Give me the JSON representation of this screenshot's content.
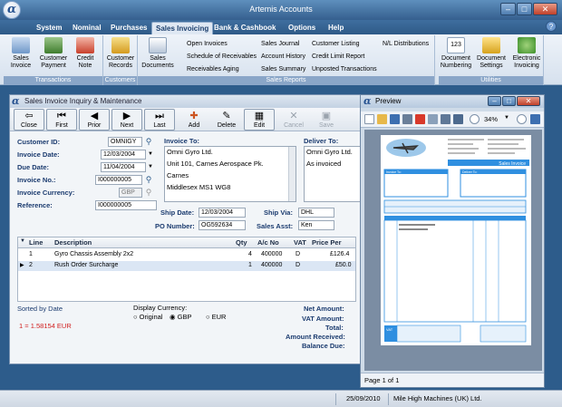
{
  "app": {
    "title": "Artemis Accounts",
    "logo_glyph": "α"
  },
  "window_controls": {
    "minimize": "–",
    "maximize": "□",
    "close": "✕"
  },
  "menu": [
    "System",
    "Nominal",
    "Purchases",
    "Sales Invoicing",
    "Bank & Cashbook",
    "Options",
    "Help"
  ],
  "help_icon": "?",
  "ribbon": {
    "transactions": {
      "label": "Transactions",
      "buttons": [
        "Sales Invoice",
        "Customer Payment",
        "Credit Note"
      ]
    },
    "customers": {
      "label": "Customers",
      "buttons": [
        "Customer Records"
      ]
    },
    "documents": {
      "buttons": [
        "Sales Documents"
      ]
    },
    "sales_reports": {
      "label": "Sales Reports",
      "links": [
        "Open Invoices",
        "Schedule of Receivables",
        "Receivables Aging",
        "Sales Journal",
        "Account History",
        "Sales Summary",
        "Customer Listing",
        "Credit Limit Report",
        "Unposted Transactions",
        "N/L Distributions"
      ]
    },
    "utilities": {
      "label": "Utilities",
      "buttons": [
        "Document Numbering",
        "Document Settings",
        "Electronic Invoicing"
      ],
      "numbering_icon_text": "123"
    }
  },
  "invoice_window": {
    "title": "Sales Invoice Inquiry & Maintenance",
    "toolbar": [
      "Close",
      "First",
      "Prior",
      "Next",
      "Last",
      "Add",
      "Delete",
      "Edit",
      "Cancel",
      "Save"
    ],
    "labels": {
      "customer_id": "Customer ID:",
      "invoice_date": "Invoice Date:",
      "due_date": "Due Date:",
      "invoice_no": "Invoice No.:",
      "invoice_currency": "Invoice Currency:",
      "reference": "Reference:",
      "invoice_to": "Invoice To:",
      "deliver_to": "Deliver To:",
      "ship_date": "Ship Date:",
      "ship_via": "Ship Via:",
      "po_number": "PO Number:",
      "sales_asst": "Sales Asst:"
    },
    "values": {
      "customer_id": "OMNIGY",
      "invoice_date": "12/03/2004",
      "due_date": "11/04/2004",
      "invoice_no": "I000000005",
      "invoice_currency": "GBP",
      "reference": "I000000005",
      "invoice_to": [
        "Omni Gyro Ltd.",
        "Unit 101, Carnes Aerospace Pk.",
        "Carnes",
        "Middlesex MS1 WG8"
      ],
      "deliver_to": [
        "Omni Gyro Ltd.",
        "As invoiced"
      ],
      "ship_date": "12/03/2004",
      "ship_via": "DHL",
      "po_number": "OG592634",
      "sales_asst": "Ken"
    },
    "grid": {
      "columns": [
        "Line",
        "Description",
        "Qty",
        "A/c No",
        "VAT",
        "Price Per"
      ],
      "rows": [
        {
          "line": "1",
          "description": "Gyro Chassis Assembly 2x2",
          "qty": "4",
          "ac_no": "400000",
          "vat": "D",
          "price": "£126.4"
        },
        {
          "line": "2",
          "description": "Rush Order Surcharge",
          "qty": "1",
          "ac_no": "400000",
          "vat": "D",
          "price": "£50.0"
        }
      ]
    },
    "footer": {
      "sorted_by": "Sorted by Date",
      "rate": "1  = 1.58154 EUR",
      "display_currency_label": "Display Currency:",
      "currency_options": [
        "Original",
        "GBP",
        "EUR"
      ],
      "selected_currency": "GBP",
      "totals_labels": [
        "Net Amount:",
        "VAT Amount:",
        "Total:",
        "Amount Received:",
        "Balance Due:"
      ]
    }
  },
  "preview_window": {
    "title": "Preview",
    "zoom": "34%",
    "page_status": "Page 1 of 1",
    "document": {
      "heading": "Sales Invoice",
      "invoice_to_label": "Invoice To:",
      "deliver_to_label": "Deliver To:",
      "vat_label": "VAT"
    }
  },
  "statusbar": {
    "date": "25/09/2010",
    "company": "Mile High Machines (UK) Ltd."
  },
  "colors": {
    "accent": "#1b3b6f",
    "desktop": "#2d5c8b",
    "rate_text": "#d11f1f",
    "preview_header": "#2f8fe0"
  }
}
